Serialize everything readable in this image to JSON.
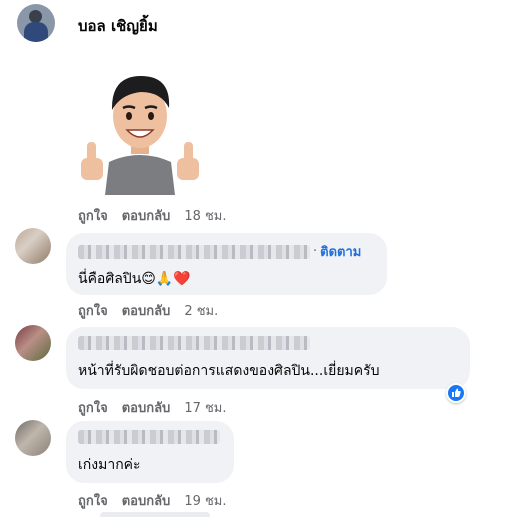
{
  "post": {
    "author_name": "บอล เชิญยิ้ม",
    "sticker_icon": "thumbs-up-avatar-sticker",
    "actions": {
      "like": "ถูกใจ",
      "reply": "ตอบกลับ",
      "time": "18 ชม."
    }
  },
  "replies": [
    {
      "follow_label": "ติดตาม",
      "text": "นี่คือศิลปิน😊🙏❤️",
      "actions": {
        "like": "ถูกใจ",
        "reply": "ตอบกลับ",
        "time": "2 ชม."
      }
    },
    {
      "text": "หน้าที่รับผิดชอบต่อการแสดงของศิลปิน...เยี่ยมครับ",
      "reaction_icon": "like-icon",
      "actions": {
        "like": "ถูกใจ",
        "reply": "ตอบกลับ",
        "time": "17 ชม."
      }
    },
    {
      "text": "เก่งมากค่ะ",
      "actions": {
        "like": "ถูกใจ",
        "reply": "ตอบกลับ",
        "time": "19 ชม."
      }
    }
  ],
  "colors": {
    "link": "#216fdb",
    "meta": "#65676b",
    "bubble": "#f0f2f5",
    "like_badge": "#1877f2"
  }
}
